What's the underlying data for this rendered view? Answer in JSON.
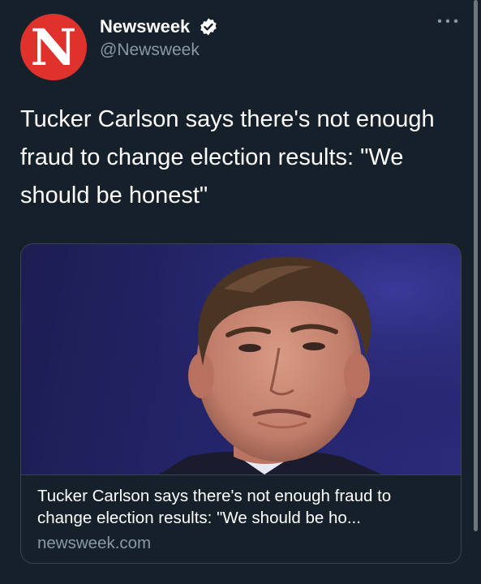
{
  "tweet": {
    "author_name": "Newsweek",
    "handle": "@Newsweek",
    "avatar_letter": "N",
    "verified": true,
    "text": "Tucker Carlson says there's not enough fraud to change election results: \"We should be honest\""
  },
  "card": {
    "title": "Tucker Carlson says there's not enough fraud to change election results: \"We should be ho...",
    "domain": "newsweek.com"
  },
  "icons": {
    "more": "more-horizontal-icon",
    "verified": "verified-badge-icon"
  },
  "colors": {
    "background": "#15202b",
    "avatar": "#e0322d",
    "secondary_text": "#8899a6",
    "verified_badge": "#ffffff",
    "card_border": "#38444d"
  }
}
